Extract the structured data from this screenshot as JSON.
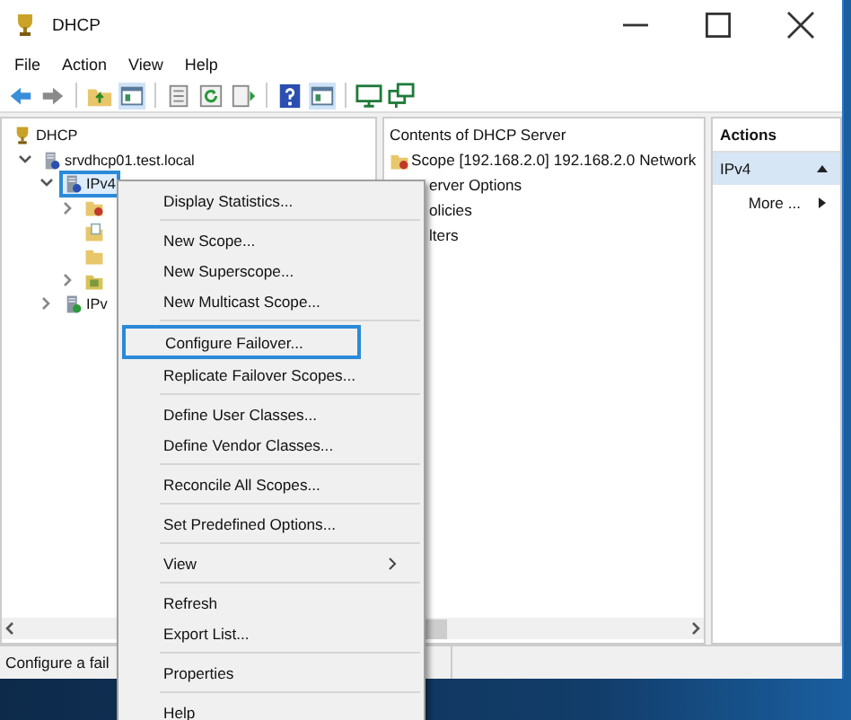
{
  "window": {
    "title": "DHCP"
  },
  "menu_bar": [
    "File",
    "Action",
    "View",
    "Help"
  ],
  "toolbar": [
    {
      "kind": "back"
    },
    {
      "kind": "forward"
    },
    {
      "kind": "sep"
    },
    {
      "kind": "up"
    },
    {
      "kind": "pane"
    },
    {
      "kind": "sep"
    },
    {
      "kind": "sheet"
    },
    {
      "kind": "refresh"
    },
    {
      "kind": "export"
    },
    {
      "kind": "sep"
    },
    {
      "kind": "help"
    },
    {
      "kind": "pane"
    },
    {
      "kind": "sep"
    },
    {
      "kind": "monitor"
    },
    {
      "kind": "monitors"
    }
  ],
  "tree": [
    {
      "label": "DHCP",
      "kind": "trophy",
      "selected": false,
      "children": [
        {
          "label": "srvdhcp01.test.local",
          "kind": "server",
          "expanded": true,
          "selected": false,
          "children": [
            {
              "label": "IPv4",
              "kind": "ipv4",
              "expanded": true,
              "selected": true,
              "children": [
                {
                  "kind": "folder-badge",
                  "expanded": false,
                  "selected": false
                },
                {
                  "kind": "folder-page",
                  "selected": false
                },
                {
                  "kind": "folder",
                  "selected": false
                },
                {
                  "kind": "folder-filter",
                  "expanded": false,
                  "selected": false
                }
              ]
            },
            {
              "label": "IPv",
              "kind": "ipv6",
              "expanded": false,
              "selected": false
            }
          ]
        }
      ]
    }
  ],
  "contents": {
    "header": "Contents of DHCP Server",
    "rows": [
      {
        "label": "Scope [192.168.2.0] 192.168.2.0 Network",
        "kind": "scope"
      },
      {
        "label": "erver Options",
        "kind": "covered"
      },
      {
        "label": "olicies",
        "kind": "covered"
      },
      {
        "label": "lters",
        "kind": "covered"
      }
    ]
  },
  "actions": {
    "header": "Actions",
    "section": "IPv4",
    "items": [
      "More ..."
    ]
  },
  "status_bar": "Configure a fail",
  "context_menu": [
    [
      {
        "label": "Display Statistics...",
        "submenu": false,
        "highlighted": false
      }
    ],
    [
      {
        "label": "New Scope...",
        "submenu": false,
        "highlighted": false
      },
      {
        "label": "New Superscope...",
        "submenu": false,
        "highlighted": false
      },
      {
        "label": "New Multicast Scope...",
        "submenu": false,
        "highlighted": false
      }
    ],
    [
      {
        "label": "Configure Failover...",
        "submenu": false,
        "highlighted": true
      },
      {
        "label": "Replicate Failover Scopes...",
        "submenu": false,
        "highlighted": false
      }
    ],
    [
      {
        "label": "Define User Classes...",
        "submenu": false,
        "highlighted": false
      },
      {
        "label": "Define Vendor Classes...",
        "submenu": false,
        "highlighted": false
      }
    ],
    [
      {
        "label": "Reconcile All Scopes...",
        "submenu": false,
        "highlighted": false
      }
    ],
    [
      {
        "label": "Set Predefined Options...",
        "submenu": false,
        "highlighted": false
      }
    ],
    [
      {
        "label": "View",
        "submenu": true,
        "highlighted": false
      }
    ],
    [
      {
        "label": "Refresh",
        "submenu": false,
        "highlighted": false
      },
      {
        "label": "Export List...",
        "submenu": false,
        "highlighted": false
      }
    ],
    [
      {
        "label": "Properties",
        "submenu": false,
        "highlighted": false
      }
    ],
    [
      {
        "label": "Help",
        "submenu": false,
        "highlighted": false
      }
    ]
  ]
}
